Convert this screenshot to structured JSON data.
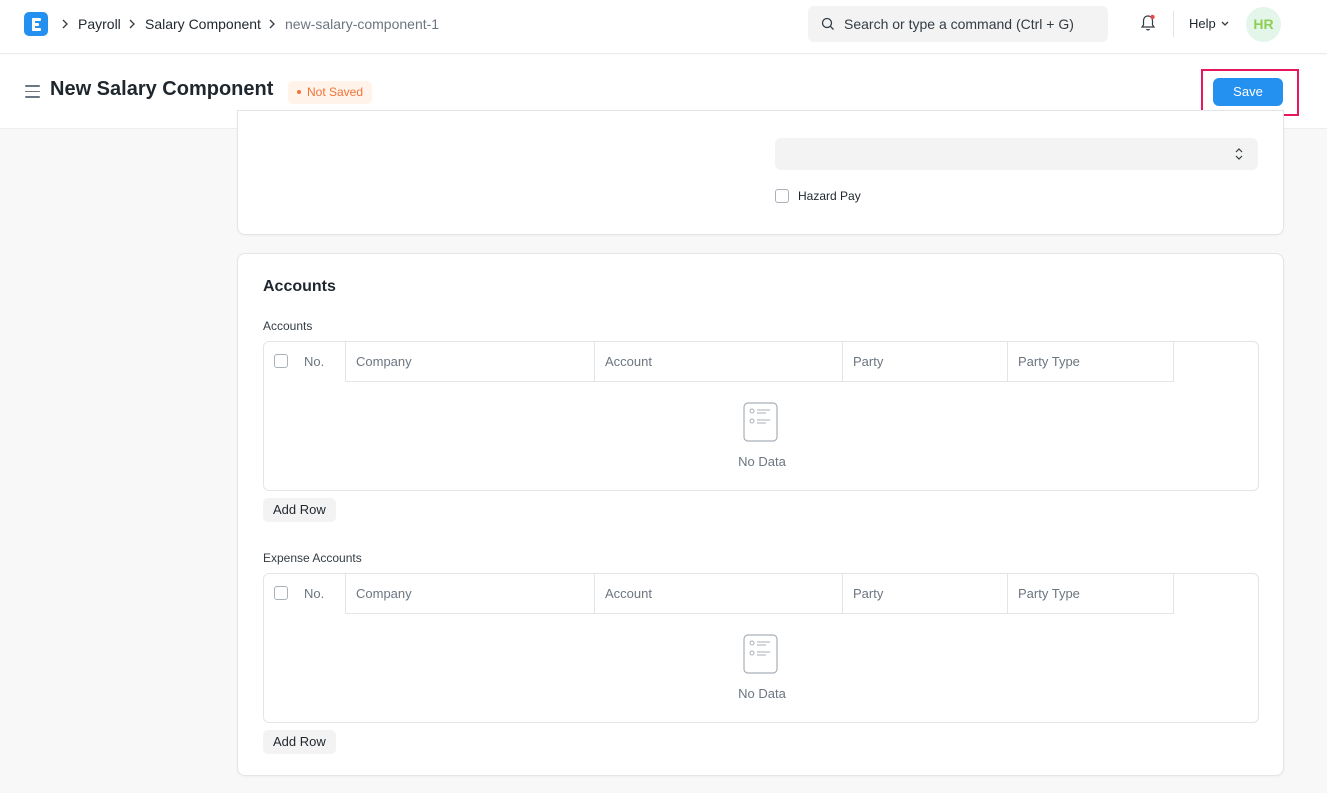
{
  "navbar": {
    "breadcrumbs": [
      "Payroll",
      "Salary Component",
      "new-salary-component-1"
    ],
    "search_placeholder": "Search or type a command (Ctrl + G)",
    "help_label": "Help",
    "avatar_initials": "HR"
  },
  "page": {
    "title": "New Salary Component",
    "status_badge": "Not Saved",
    "save_label": "Save"
  },
  "top_section": {
    "select_value": "",
    "hazard_pay_label": "Hazard Pay",
    "hazard_pay_checked": false
  },
  "accounts_section": {
    "title": "Accounts",
    "tables": [
      {
        "label": "Accounts",
        "columns": [
          "No.",
          "Company",
          "Account",
          "Party",
          "Party Type"
        ],
        "rows": [],
        "empty_text": "No Data",
        "add_row_label": "Add Row"
      },
      {
        "label": "Expense Accounts",
        "columns": [
          "No.",
          "Company",
          "Account",
          "Party",
          "Party Type"
        ],
        "rows": [],
        "empty_text": "No Data",
        "add_row_label": "Add Row"
      }
    ]
  },
  "colors": {
    "primary": "#2490ef",
    "not_saved": "#f0743a",
    "highlight": "#e8175d",
    "avatar_text": "#8ccf54"
  }
}
